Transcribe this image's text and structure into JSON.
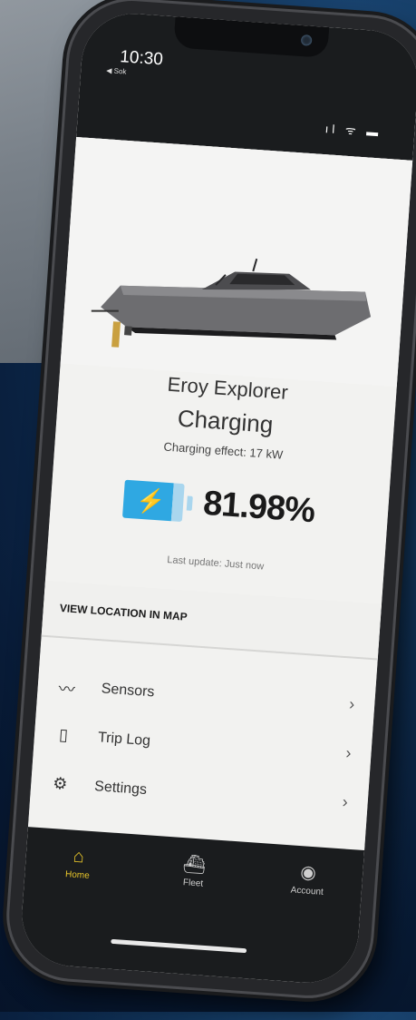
{
  "status_bar": {
    "time": "10:30",
    "back_app": "◀ Sok",
    "signal_icons": "ıl ᯤ ▬"
  },
  "vessel": {
    "name": "Eroy Explorer",
    "status": "Charging",
    "charging_effect": "Charging effect: 17 kW",
    "battery_percent": "81.98%",
    "battery_level": 0.8198,
    "last_update": "Last update: Just now"
  },
  "map_link": {
    "label": "VIEW LOCATION IN MAP"
  },
  "menu": [
    {
      "label": "Sensors",
      "icon": "chart-line-icon",
      "glyph": "〰"
    },
    {
      "label": "Trip Log",
      "icon": "map-icon",
      "glyph": "▯"
    },
    {
      "label": "Settings",
      "icon": "gear-icon",
      "glyph": "⚙"
    }
  ],
  "tabs": [
    {
      "label": "Home",
      "icon": "home-icon",
      "glyph": "⌂"
    },
    {
      "label": "Fleet",
      "icon": "ship-icon",
      "glyph": "⛴"
    },
    {
      "label": "Account",
      "icon": "account-icon",
      "glyph": "◉"
    }
  ],
  "colors": {
    "accent_active": "#e9c62a",
    "battery_blue": "#2fa8e2",
    "battery_light": "#a9d6ee",
    "tabbar_bg": "#1a1c1e"
  }
}
